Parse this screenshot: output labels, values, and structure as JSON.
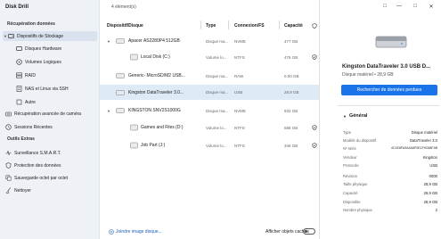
{
  "app": {
    "title": "Disk Drill"
  },
  "sidebar": {
    "section_recovery": "Récupération données",
    "storage_devices": "Dispositifs de Stockage",
    "sub_items": [
      {
        "label": "Disques Hardware",
        "icon": "hard-disk-icon"
      },
      {
        "label": "Volumes Logiques",
        "icon": "volume-icon"
      },
      {
        "label": "RAID",
        "icon": "raid-icon"
      },
      {
        "label": "NAS et Linux via SSH",
        "icon": "nas-icon"
      },
      {
        "label": "Autre",
        "icon": "other-icon"
      }
    ],
    "camera_recovery": "Récupération avancée de caméra",
    "sessions": "Sessions Récentes",
    "section_extras": "Outils Extras",
    "extras": [
      {
        "label": "Surveillance S.M.A.R.T.",
        "icon": "smart-icon"
      },
      {
        "label": "Protection des données",
        "icon": "shield-icon"
      },
      {
        "label": "Sauvegarde octet par octet",
        "icon": "backup-icon"
      },
      {
        "label": "Nettoyer",
        "icon": "broom-icon"
      }
    ]
  },
  "main": {
    "count": "4 élément(s)",
    "columns": {
      "device": "Dispositif/Disque",
      "type": "Type",
      "connection": "Connexion/FS",
      "capacity": "Capacité"
    },
    "rows": [
      {
        "name": "Apacer AS2280P4 512GB",
        "type": "Disque ma...",
        "conn": "NVME",
        "cap": "477 GB",
        "kind": "disk",
        "expanded": true
      },
      {
        "name": "Local Disk (C:)",
        "type": "Volume lo...",
        "conn": "NTFS",
        "cap": "476 GB",
        "kind": "volume",
        "protected": true
      },
      {
        "name": "Generic- MicroSD/M2 USB...",
        "type": "Disque ma...",
        "conn": "RAW",
        "cap": "0.00 GB",
        "kind": "disk"
      },
      {
        "name": "Kingston DataTraveler 3.0...",
        "type": "Disque ma...",
        "conn": "USB",
        "cap": "28,9 GB",
        "kind": "usb",
        "selected": true
      },
      {
        "name": "KINGSTON SNV2S1000G",
        "type": "Disque ma...",
        "conn": "NVME",
        "cap": "932 GB",
        "kind": "disk",
        "expanded": true
      },
      {
        "name": "Games and Files (D:)",
        "type": "Volume lo...",
        "conn": "NTFS",
        "cap": "586 GB",
        "kind": "volume",
        "protected": true
      },
      {
        "name": "Job Part (J:)",
        "type": "Volume lo...",
        "conn": "NTFS",
        "cap": "346 GB",
        "kind": "volume",
        "protected": true
      }
    ],
    "attach_link": "Joindre image disque...",
    "show_hidden": "Afficher objets cachés"
  },
  "panel": {
    "device_title": "Kingston DataTraveler 3.0 USB D...",
    "device_sub": "Disque matériel • 28,9 GB",
    "recover_button": "Rechercher de données perdues",
    "general": "Général",
    "props": [
      {
        "k": "Type",
        "v": "Disque matériel"
      },
      {
        "k": "Modèle du dispositif",
        "v": "DataTraveler 3.0"
      },
      {
        "k": "Nº série",
        "v": "4C1E8FA3A4A5F0E1F9C88F4B"
      },
      {
        "k": "Vendeur",
        "v": "Kingston"
      },
      {
        "k": "Protocole",
        "v": "USB"
      },
      {
        "k": "Révision",
        "v": "0000"
      },
      {
        "k": "Taille physique",
        "v": "28,9 GB"
      },
      {
        "k": "Capacité",
        "v": "28,9 GB"
      },
      {
        "k": "Disponible",
        "v": "28,9 GB"
      },
      {
        "k": "Nombre physique",
        "v": "2"
      }
    ]
  },
  "colors": {
    "accent": "#1a73e8",
    "selection": "#dfeaf7",
    "sidebar": "#eef2f6"
  }
}
